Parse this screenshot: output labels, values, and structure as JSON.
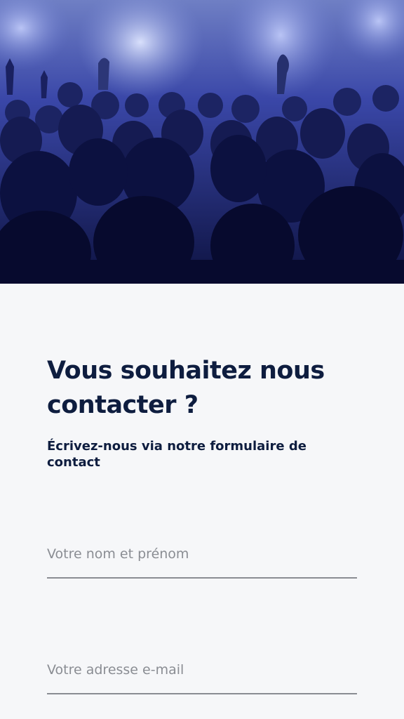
{
  "hero": {
    "image": "concert-crowd-photo",
    "tint": "#2a36a8"
  },
  "contact": {
    "title": "Vous souhaitez nous contacter ?",
    "subtitle": "Écrivez-nous via notre formulaire de contact"
  },
  "form": {
    "name_placeholder": "Votre nom et prénom",
    "email_placeholder": "Votre adresse e-mail",
    "name_value": "",
    "email_value": ""
  },
  "colors": {
    "heading": "#0e1d3f",
    "background": "#f6f7f9",
    "field_line": "#8a8d93"
  }
}
